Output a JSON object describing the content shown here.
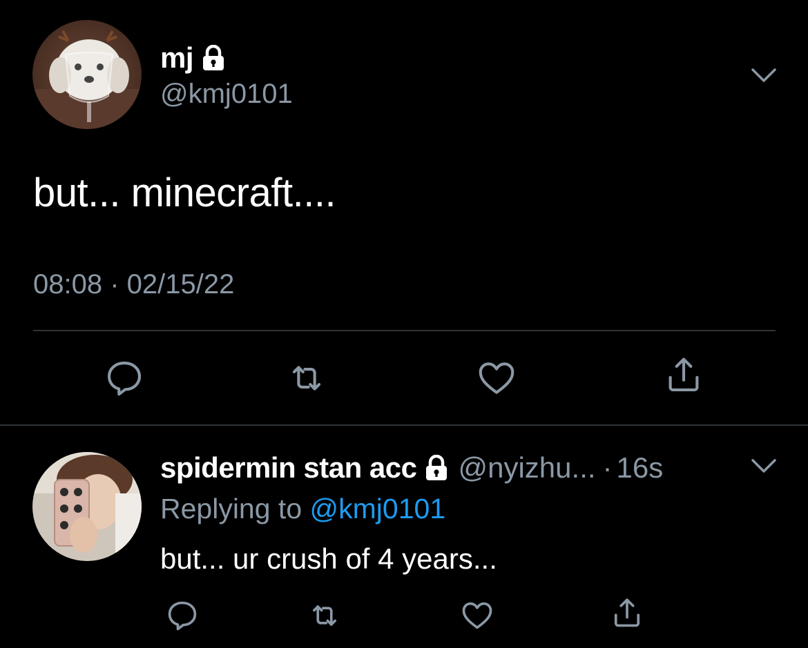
{
  "colors": {
    "background": "#000000",
    "text_primary": "#ffffff",
    "text_secondary": "#8b98a5",
    "accent_link": "#1d9bf0",
    "divider": "#2f3336"
  },
  "main_tweet": {
    "display_name": "mj",
    "handle": "@kmj0101",
    "protected_icon": "lock-icon",
    "text": "but... minecraft....",
    "timestamp": "08:08 · 02/15/22",
    "actions": [
      "reply-icon",
      "retweet-icon",
      "like-icon",
      "share-icon"
    ]
  },
  "reply_tweet": {
    "display_name": "spidermin stan acc",
    "protected_icon": "lock-icon",
    "handle": "@nyizhu...",
    "separator": "·",
    "age": "16s",
    "replying_to_label": "Replying to",
    "replying_to_handle": "@kmj0101",
    "text": "but... ur crush of 4 years...",
    "actions": [
      "reply-icon",
      "retweet-icon",
      "like-icon",
      "share-icon"
    ]
  }
}
